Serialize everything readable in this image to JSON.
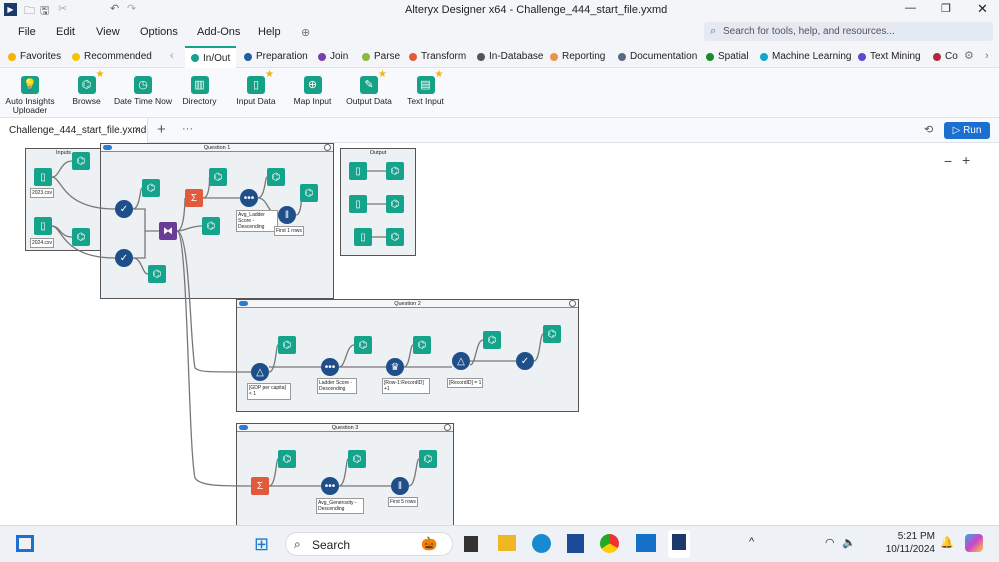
{
  "window": {
    "title": "Alteryx Designer x64 - Challenge_444_start_file.yxmd"
  },
  "menu": [
    "File",
    "Edit",
    "View",
    "Options",
    "Add-Ons",
    "Help"
  ],
  "search": {
    "placeholder": "Search for tools, help, and resources..."
  },
  "categories": [
    {
      "label": "Favorites",
      "color": "#f5b400"
    },
    {
      "label": "Recommended",
      "color": "#f5c400"
    },
    {
      "label": "In/Out",
      "color": "#15a38c"
    },
    {
      "label": "Preparation",
      "color": "#1f5fa8"
    },
    {
      "label": "Join",
      "color": "#7a3fa8"
    },
    {
      "label": "Parse",
      "color": "#8cb83c"
    },
    {
      "label": "Transform",
      "color": "#e25a3c"
    },
    {
      "label": "In-Database",
      "color": "#555"
    },
    {
      "label": "Reporting",
      "color": "#e8954a"
    },
    {
      "label": "Documentation",
      "color": "#5a6a80"
    },
    {
      "label": "Spatial",
      "color": "#1a8a2a"
    },
    {
      "label": "Machine Learning",
      "color": "#10a8c8"
    },
    {
      "label": "Text Mining",
      "color": "#5a4ad0"
    },
    {
      "label": "Co",
      "color": "#b02a3a"
    }
  ],
  "palette": [
    {
      "label": "Auto Insights Uploader",
      "icon": "lightbulb-icon",
      "fav": false
    },
    {
      "label": "Browse",
      "icon": "binoculars-icon",
      "fav": true
    },
    {
      "label": "Date Time Now",
      "icon": "clock-icon",
      "fav": false
    },
    {
      "label": "Directory",
      "icon": "directory-icon",
      "fav": false
    },
    {
      "label": "Input Data",
      "icon": "book-icon",
      "fav": true
    },
    {
      "label": "Map Input",
      "icon": "globe-icon",
      "fav": false
    },
    {
      "label": "Output Data",
      "icon": "output-icon",
      "fav": true
    },
    {
      "label": "Text Input",
      "icon": "text-input-icon",
      "fav": true
    }
  ],
  "tab": {
    "label": "Challenge_444_start_file.yxmd"
  },
  "run_label": "Run",
  "containers": {
    "inputs": "Inputs",
    "q1": "Question 1",
    "output": "Output",
    "q2": "Question 2",
    "q3": "Question 3"
  },
  "annotations": {
    "csv2023": "2023.csv",
    "csv2024": "2024.csv",
    "q1sort": "Avg_Ladder Score - Descending",
    "q1sample": "First 1 rows",
    "q2filter": "[GDP per capita] < 1",
    "q2sort": "Ladder Score - Descending",
    "q2multirow": "[Row-1:RecordID] +1",
    "q2filter2": "[RecordID] = 1",
    "q3sort": "Avg_Generosity - Descending",
    "q3sample": "First 5 rows"
  },
  "taskbar": {
    "search": "Search",
    "time": "5:21 PM",
    "date": "10/11/2024"
  }
}
